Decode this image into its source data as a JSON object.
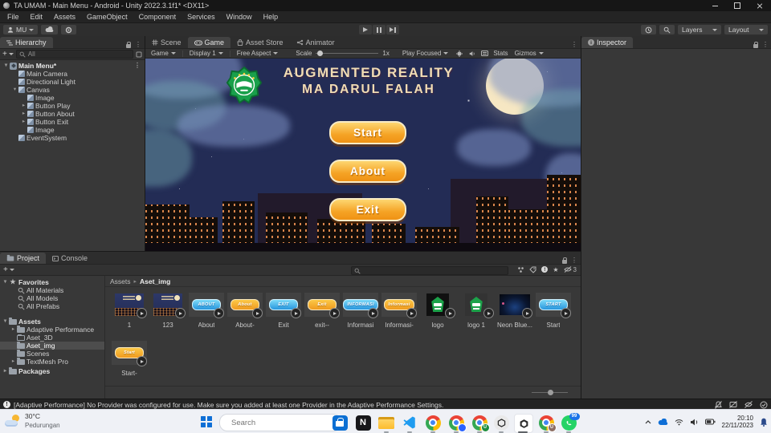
{
  "window": {
    "title": "TA UMAM - Main Menu - Android - Unity 2022.3.1f1* <DX11>",
    "menus": [
      "File",
      "Edit",
      "Assets",
      "GameObject",
      "Component",
      "Services",
      "Window",
      "Help"
    ]
  },
  "toolbar": {
    "account": "MU",
    "layers": "Layers",
    "layout": "Layout"
  },
  "hierarchy": {
    "tab": "Hierarchy",
    "search_scope": "All",
    "items": [
      {
        "label": "Main Menu*",
        "depth": 0,
        "arrow": "expanded",
        "icon": "scene",
        "scene": true
      },
      {
        "label": "Main Camera",
        "depth": 1,
        "icon": "cube"
      },
      {
        "label": "Directional Light",
        "depth": 1,
        "icon": "cube"
      },
      {
        "label": "Canvas",
        "depth": 1,
        "arrow": "expanded",
        "icon": "cube"
      },
      {
        "label": "Image",
        "depth": 2,
        "icon": "cube"
      },
      {
        "label": "Button Play",
        "depth": 2,
        "arrow": "collapsed",
        "icon": "cube"
      },
      {
        "label": "Button About",
        "depth": 2,
        "arrow": "collapsed",
        "icon": "cube"
      },
      {
        "label": "Button Exit",
        "depth": 2,
        "arrow": "collapsed",
        "icon": "cube"
      },
      {
        "label": "Image",
        "depth": 2,
        "icon": "cube"
      },
      {
        "label": "EventSystem",
        "depth": 1,
        "icon": "cube"
      }
    ]
  },
  "game": {
    "tabs": [
      {
        "label": "Scene"
      },
      {
        "label": "Game"
      },
      {
        "label": "Asset Store"
      },
      {
        "label": "Animator"
      }
    ],
    "toolbar": {
      "target": "Game",
      "display": "Display 1",
      "aspect": "Free Aspect",
      "scale_label": "Scale",
      "scale_value": "1x",
      "focus": "Play Focused",
      "stats": "Stats",
      "gizmos": "Gizmos"
    },
    "title_line1": "AUGMENTED REALITY",
    "title_line2": "MA DARUL FALAH",
    "menu_buttons": [
      "Start",
      "About",
      "Exit"
    ]
  },
  "inspector": {
    "tab": "Inspector"
  },
  "project": {
    "tab_project": "Project",
    "tab_console": "Console",
    "breadcrumb_root": "Assets",
    "breadcrumb_current": "Aset_img",
    "hidden_count": "3",
    "tree": [
      {
        "label": "Favorites",
        "depth": 0,
        "arrow": "expanded",
        "icon": "star",
        "head": true
      },
      {
        "label": "All Materials",
        "depth": 1,
        "icon": "search"
      },
      {
        "label": "All Models",
        "depth": 1,
        "icon": "search"
      },
      {
        "label": "All Prefabs",
        "depth": 1,
        "icon": "search"
      },
      {
        "label": "Assets",
        "depth": 0,
        "arrow": "expanded",
        "icon": "folder",
        "head": true,
        "gap": 9
      },
      {
        "label": "Adaptive Performance",
        "depth": 1,
        "arrow": "collapsed",
        "icon": "folder"
      },
      {
        "label": "Aset_3D",
        "depth": 1,
        "icon": "folder-empty"
      },
      {
        "label": "Aset_img",
        "depth": 1,
        "icon": "folder",
        "selected": true
      },
      {
        "label": "Scenes",
        "depth": 1,
        "icon": "folder"
      },
      {
        "label": "TextMesh Pro",
        "depth": 1,
        "arrow": "collapsed",
        "icon": "folder"
      },
      {
        "label": "Packages",
        "depth": 0,
        "arrow": "collapsed",
        "icon": "folder",
        "head": true,
        "gap": 2
      }
    ],
    "items": [
      {
        "name": "1",
        "kind": "scene"
      },
      {
        "name": "123",
        "kind": "scene"
      },
      {
        "name": "About",
        "kind": "pill-blue",
        "text": "ABOUT"
      },
      {
        "name": "About-",
        "kind": "pill-orange",
        "text": "About"
      },
      {
        "name": "Exit",
        "kind": "pill-blue",
        "text": "EXIT"
      },
      {
        "name": "exit--",
        "kind": "pill-orange",
        "text": "Exit"
      },
      {
        "name": "Informasi",
        "kind": "pill-blue",
        "text": "INFORMASI"
      },
      {
        "name": "Informasi-",
        "kind": "pill-orange",
        "text": "Informasi"
      },
      {
        "name": "logo",
        "kind": "logo-black"
      },
      {
        "name": "logo 1",
        "kind": "logo"
      },
      {
        "name": "Neon Blue...",
        "kind": "neon"
      },
      {
        "name": "Start",
        "kind": "pill-blue",
        "text": "START"
      },
      {
        "name": "Start-",
        "kind": "pill-orange",
        "text": "Start"
      }
    ]
  },
  "statusbar": {
    "message": "[Adaptive Performance] No Provider was configured for use. Make sure you added at least one Provider in the Adaptive Performance Settings."
  },
  "taskbar": {
    "weather_temp": "30°C",
    "weather_location": "Pedurungan",
    "search_placeholder": "Search",
    "notion_letter": "N",
    "chrome_badges": [
      "",
      "U",
      "U"
    ],
    "whatsapp_badge": "99",
    "time": "20:10",
    "date": "22/11/2023"
  },
  "colors": {
    "accent_orange": "#f5a325",
    "accent_blue": "#2795dd",
    "game_bg": "#232c55",
    "title_cream": "#f2ddb4"
  }
}
